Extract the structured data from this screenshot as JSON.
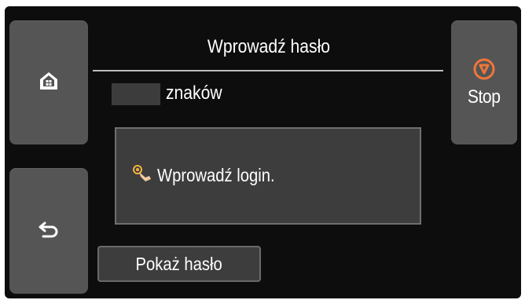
{
  "screen": {
    "title": "Wprowadź hasło",
    "char_count_label": "znaków"
  },
  "message": {
    "text": "Wprowadź login.",
    "icon": "finger-tap-icon"
  },
  "buttons": {
    "home_icon": "home-icon",
    "back_icon": "back-arrow-icon",
    "stop_label": "Stop",
    "stop_icon": "stop-icon",
    "show_password_label": "Pokaż hasło"
  },
  "colors": {
    "stop_accent": "#f0763a",
    "panel_bg": "#3d3d3d",
    "button_bg": "#555555",
    "screen_bg": "#0d0d0d"
  }
}
